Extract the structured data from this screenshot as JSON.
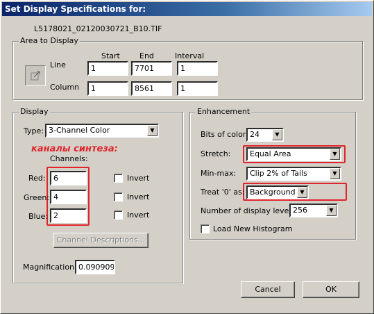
{
  "window": {
    "title": "Set Display Specifications for:",
    "filename": "L5178021_02120030721_B10.TIF"
  },
  "area": {
    "title": "Area to Display",
    "col_start": "Start",
    "col_end": "End",
    "col_interval": "Interval",
    "line_label": "Line",
    "column_label": "Column",
    "line_start": "1",
    "line_end": "7701",
    "line_interval": "1",
    "column_start": "1",
    "column_end": "8561",
    "column_interval": "1"
  },
  "display": {
    "title": "Display",
    "type_label": "Type:",
    "type_value": "3-Channel Color",
    "annotation": "каналы синтеза:",
    "channels_label": "Channels:",
    "red_label": "Red:",
    "red_value": "6",
    "green_label": "Green:",
    "green_value": "4",
    "blue_label": "Blue:",
    "blue_value": "2",
    "invert_label": "Invert",
    "channel_desc_button": "Channel Descriptions...",
    "magnification_label": "Magnification:",
    "magnification_value": "0.0909090"
  },
  "enhancement": {
    "title": "Enhancement",
    "bits_label": "Bits of color:",
    "bits_value": "24",
    "stretch_label": "Stretch:",
    "stretch_value": "Equal Area",
    "minmax_label": "Min-max:",
    "minmax_value": "Clip 2% of Tails",
    "treat_label": "Treat '0' as:",
    "treat_value": "Background",
    "levels_label": "Number of display levels:",
    "levels_value": "256",
    "load_histogram_label": "Load New Histogram"
  },
  "buttons": {
    "cancel": "Cancel",
    "ok": "OK"
  },
  "colors": {
    "highlight": "#e0242c",
    "titlebar": "#0a246a",
    "face": "#d4d0c8"
  }
}
